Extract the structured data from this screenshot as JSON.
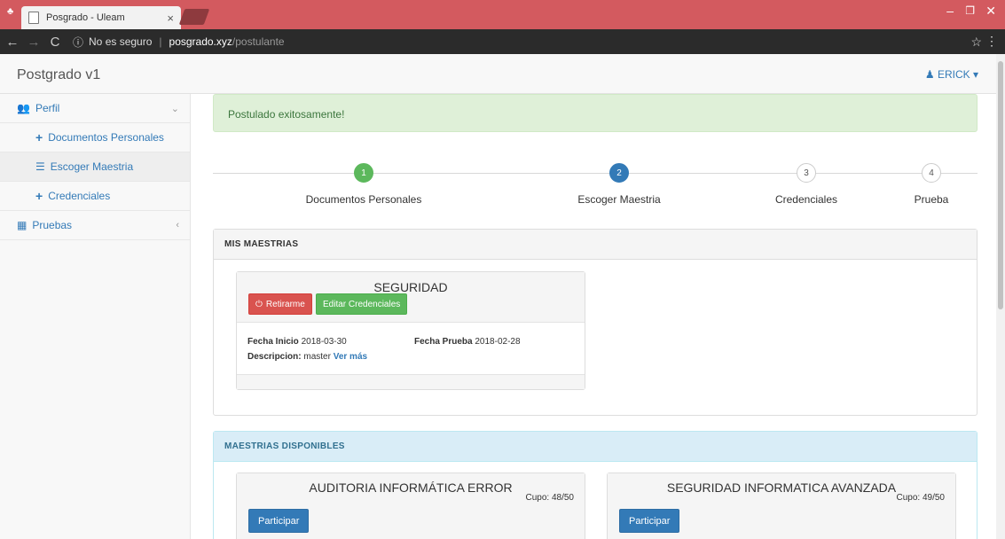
{
  "browser": {
    "tab_title": "Posgrado - Uleam",
    "tab_close": "×",
    "security": "No es seguro",
    "url_host": "posgrado.xyz",
    "url_path": "/postulante"
  },
  "app": {
    "brand": "Postgrado v1",
    "user": "ERICK"
  },
  "sidebar": {
    "items": [
      {
        "label": "Perfil",
        "icon": "users-icon"
      },
      {
        "label": "Documentos Personales",
        "icon": "plus-icon"
      },
      {
        "label": "Escoger Maestria",
        "icon": "list-icon"
      },
      {
        "label": "Credenciales",
        "icon": "plus-icon"
      },
      {
        "label": "Pruebas",
        "icon": "film-icon"
      }
    ]
  },
  "alert": "Postulado exitosamente!",
  "steps": [
    {
      "num": "1",
      "label": "Documentos Personales",
      "state": "done"
    },
    {
      "num": "2",
      "label": "Escoger Maestria",
      "state": "current"
    },
    {
      "num": "3",
      "label": "Credenciales",
      "state": "todo"
    },
    {
      "num": "4",
      "label": "Prueba",
      "state": "todo"
    }
  ],
  "mis_maestrias": {
    "heading": "MIS MAESTRIAS",
    "card": {
      "title": "SEGURIDAD",
      "retirarme": "Retirarme",
      "editar": "Editar Credenciales",
      "fecha_inicio_label": "Fecha Inicio",
      "fecha_inicio": "2018-03-30",
      "fecha_prueba_label": "Fecha Prueba",
      "fecha_prueba": "2018-02-28",
      "descripcion_label": "Descripcion:",
      "descripcion": "master",
      "ver_mas": "Ver más"
    }
  },
  "disponibles": {
    "heading": "MAESTRIAS DISPONIBLES",
    "cards": [
      {
        "title": "AUDITORIA INFORMÁTICA ERROR",
        "cupo": "Cupo: 48/50",
        "button": "Participar"
      },
      {
        "title": "SEGURIDAD INFORMATICA AVANZADA",
        "cupo": "Cupo: 49/50",
        "button": "Participar"
      }
    ]
  },
  "colors": {
    "titlebar": "#d35a5f",
    "success": "#5cb85c",
    "primary": "#337ab7",
    "danger": "#d9534f"
  }
}
